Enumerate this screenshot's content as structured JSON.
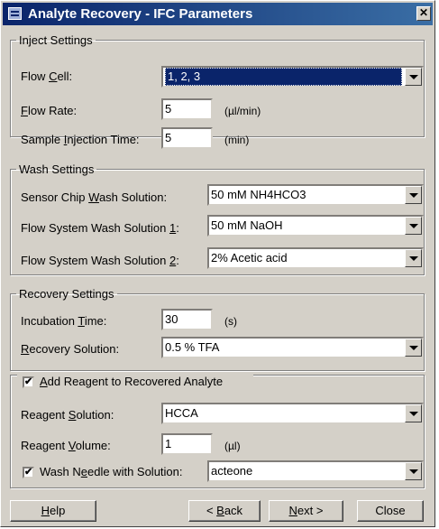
{
  "window": {
    "title": "Analyte Recovery - IFC Parameters",
    "close_glyph": "✕"
  },
  "inject": {
    "legend": "Inject Settings",
    "flow_cell": {
      "pre": "Flow ",
      "key": "C",
      "post": "ell:",
      "value": "1, 2, 3"
    },
    "flow_rate": {
      "pre": "",
      "key": "F",
      "post": "low Rate:",
      "value": "5",
      "unit": "(µl/min)"
    },
    "sample_time": {
      "pre": "Sample ",
      "key": "I",
      "post": "njection Time:",
      "value": "5",
      "unit": "(min)"
    }
  },
  "wash": {
    "legend": "Wash Settings",
    "chip": {
      "pre": "Sensor Chip ",
      "key": "W",
      "post": "ash Solution:",
      "value": "50 mM NH4HCO3"
    },
    "sol1": {
      "pre": "Flow System Wash Solution ",
      "key": "1",
      "post": ":",
      "value": "50 mM NaOH"
    },
    "sol2": {
      "pre": "Flow System Wash Solution ",
      "key": "2",
      "post": ":",
      "value": "2% Acetic acid"
    }
  },
  "recovery": {
    "legend": "Recovery Settings",
    "incubation": {
      "pre": "Incubation ",
      "key": "T",
      "post": "ime:",
      "value": "30",
      "unit": "(s)"
    },
    "solution": {
      "pre": "",
      "key": "R",
      "post": "ecovery Solution:",
      "value": "0.5 % TFA"
    }
  },
  "reagent": {
    "checkbox": {
      "checked": "✔",
      "pre": "",
      "key": "A",
      "post": "dd Reagent to Recovered Analyte"
    },
    "solution": {
      "pre": "Reagent ",
      "key": "S",
      "post": "olution:",
      "value": "HCCA"
    },
    "volume": {
      "pre": "Reagent ",
      "key": "V",
      "post": "olume:",
      "value": "1",
      "unit": "(µl)"
    },
    "needle": {
      "checked": "✔",
      "pre": "Wash N",
      "key": "e",
      "post": "edle with Solution:",
      "value": "acteone"
    }
  },
  "buttons": {
    "help": {
      "pre": "",
      "key": "H",
      "post": "elp"
    },
    "back": {
      "pre": "< ",
      "key": "B",
      "post": "ack"
    },
    "next": {
      "pre": "",
      "key": "N",
      "post": "ext >"
    },
    "close": {
      "label": "Close"
    }
  }
}
